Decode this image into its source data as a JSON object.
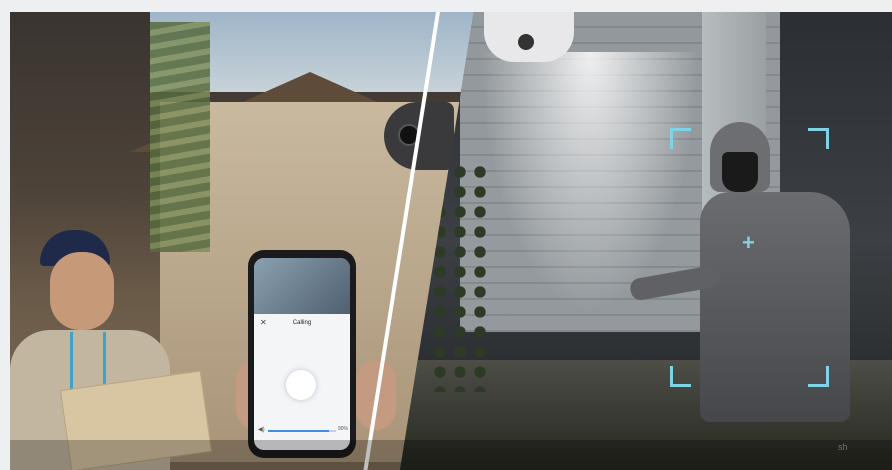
{
  "phone": {
    "close_icon": "close-icon",
    "screen_title": "Calling",
    "volume_icon": "speaker-icon",
    "volume_level": 0.9,
    "volume_text": "90%"
  },
  "overlay": {
    "watermark": "sh",
    "bracket_color": "#7fd3e6"
  }
}
